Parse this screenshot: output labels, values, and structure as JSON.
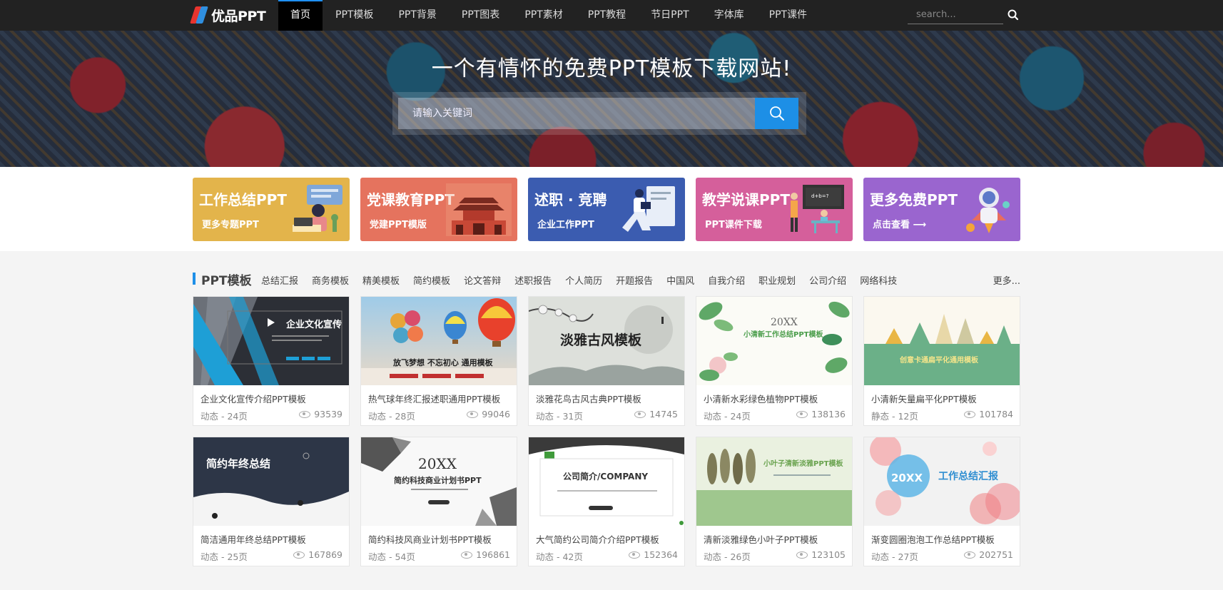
{
  "brand": {
    "name": "优品PPT"
  },
  "nav": {
    "items": [
      "首页",
      "PPT模板",
      "PPT背景",
      "PPT图表",
      "PPT素材",
      "PPT教程",
      "节日PPT",
      "字体库",
      "PPT课件"
    ],
    "active_index": 0,
    "search_placeholder": "search..."
  },
  "hero": {
    "title": "一个有情怀的免费PPT模板下载网站!",
    "search_placeholder": "请输入关键词"
  },
  "banners": [
    {
      "title": "工作总结PPT",
      "subtitle": "更多专题PPT",
      "color": "#e3b44b"
    },
    {
      "title": "党课教育PPT",
      "subtitle": "党建PPT模版",
      "color": "#e5735e"
    },
    {
      "title": "述职 · 竞聘",
      "subtitle": "企业工作PPT",
      "color": "#3b5cb0"
    },
    {
      "title": "教学说课PPT",
      "subtitle": "PPT课件下载",
      "color": "#d55f9b"
    },
    {
      "title": "更多免费PPT",
      "subtitle": "点击查看 ⟶",
      "color": "#9a65cf"
    }
  ],
  "section": {
    "title": "PPT模板",
    "tags": [
      "总结汇报",
      "商务模板",
      "精美模板",
      "简约模板",
      "论文答辩",
      "述职报告",
      "个人简历",
      "开题报告",
      "中国风",
      "自我介绍",
      "职业规划",
      "公司介绍",
      "网络科技"
    ],
    "more": "更多..."
  },
  "cards": [
    {
      "title": "企业文化宣传介绍PPT模板",
      "meta": "动态 - 24页",
      "views": "93539",
      "thumb_text": "企业文化宣传"
    },
    {
      "title": "热气球年终汇报述职通用PPT模板",
      "meta": "动态 - 28页",
      "views": "99046",
      "thumb_text": "放飞梦想 不忘初心 通用模板"
    },
    {
      "title": "淡雅花鸟古风古典PPT模板",
      "meta": "动态 - 31页",
      "views": "14745",
      "thumb_text": "淡雅古风模板"
    },
    {
      "title": "小清新水彩绿色植物PPT模板",
      "meta": "动态 - 24页",
      "views": "138136",
      "thumb_text": "小清新工作总结PPT模板"
    },
    {
      "title": "小清新矢量扁平化PPT模板",
      "meta": "静态 - 12页",
      "views": "101784",
      "thumb_text": "创意卡通扁平化通用模板"
    },
    {
      "title": "简洁通用年终总结PPT模板",
      "meta": "动态 - 25页",
      "views": "167869",
      "thumb_text": "简约年终总结"
    },
    {
      "title": "简约科技风商业计划书PPT模板",
      "meta": "动态 - 54页",
      "views": "196861",
      "thumb_text": "简约科技商业计划书PPT"
    },
    {
      "title": "大气简约公司简介介绍PPT模板",
      "meta": "动态 - 42页",
      "views": "152364",
      "thumb_text": "公司简介/COMPANY"
    },
    {
      "title": "清新淡雅绿色小叶子PPT模板",
      "meta": "动态 - 26页",
      "views": "123105",
      "thumb_text": "小叶子清新淡雅PPT模板"
    },
    {
      "title": "渐变圆圈泡泡工作总结PPT模板",
      "meta": "动态 - 27页",
      "views": "202751",
      "thumb_text": "工作总结汇报"
    }
  ]
}
